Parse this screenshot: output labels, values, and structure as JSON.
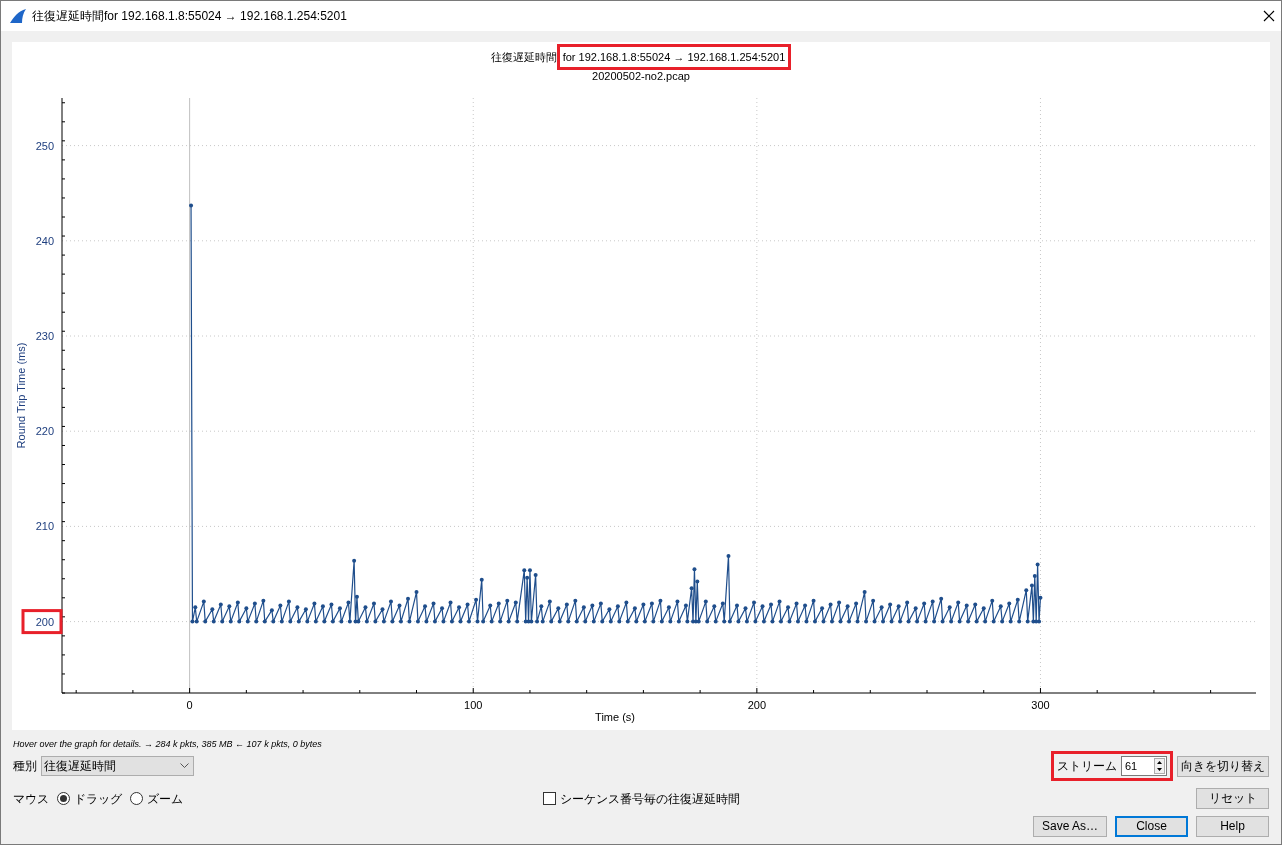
{
  "window": {
    "title": "往復遅延時間for 192.168.1.8:55024 → 192.168.1.254:5201"
  },
  "graph": {
    "title_parts": [
      {
        "text": "往復遅延時間",
        "highlighted": false
      },
      {
        "text": "for 192.168.1.8:55024 → 192.168.1.254:5201",
        "highlighted": true
      }
    ],
    "subtitle": "20200502-no2.pcap",
    "frames": [
      {
        "kind": "y_tick",
        "tick": "200"
      }
    ],
    "chart_data": {
      "type": "line",
      "grid": true,
      "xlabel": "Time (s)",
      "ylabel": "Round Trip Time (ms)",
      "xlim": [
        -45,
        376
      ],
      "ylim": [
        192.5,
        255
      ],
      "xticks": [
        0,
        100,
        200,
        300
      ],
      "yticks": [
        200,
        210,
        220,
        230,
        240,
        250
      ],
      "x": [
        0.5,
        1,
        2,
        2.5,
        5,
        5.5,
        8,
        8.5,
        11,
        11.5,
        14,
        14.5,
        17,
        17.5,
        20,
        20.5,
        23,
        23.5,
        26,
        26.5,
        29,
        29.5,
        32,
        32.5,
        35,
        35.5,
        38,
        38.5,
        41,
        41.5,
        44,
        44.5,
        47,
        47.5,
        50,
        50.5,
        53,
        53.5,
        56,
        56.5,
        58,
        58.5,
        59,
        59.5,
        62,
        62.5,
        65,
        65.5,
        68,
        68.5,
        71,
        71.5,
        74,
        74.5,
        77,
        77.5,
        80,
        80.5,
        83,
        83.5,
        86,
        86.5,
        89,
        89.5,
        92,
        92.5,
        95,
        95.5,
        98,
        98.5,
        101,
        101.5,
        103,
        103.5,
        106,
        106.5,
        109,
        109.5,
        112,
        112.5,
        115,
        115.5,
        118,
        118.5,
        119,
        119.5,
        120,
        120.5,
        122,
        122.5,
        124,
        124.5,
        127,
        127.5,
        130,
        130.5,
        133,
        133.5,
        136,
        136.5,
        139,
        139.5,
        142,
        142.5,
        145,
        145.5,
        148,
        148.5,
        151,
        151.5,
        154,
        154.5,
        157,
        157.5,
        160,
        160.5,
        163,
        163.5,
        166,
        166.5,
        169,
        169.5,
        172,
        172.5,
        175,
        175.5,
        177,
        177.5,
        178,
        178.5,
        179,
        179.5,
        182,
        182.5,
        185,
        185.5,
        188,
        188.5,
        190,
        190.5,
        193,
        193.5,
        196,
        196.5,
        199,
        199.5,
        202,
        202.5,
        205,
        205.5,
        208,
        208.5,
        211,
        211.5,
        214,
        214.5,
        217,
        217.5,
        220,
        220.5,
        223,
        223.5,
        226,
        226.5,
        229,
        229.5,
        232,
        232.5,
        235,
        235.5,
        238,
        238.5,
        241,
        241.5,
        244,
        244.5,
        247,
        247.5,
        250,
        250.5,
        253,
        253.5,
        256,
        256.5,
        259,
        259.5,
        262,
        262.5,
        265,
        265.5,
        268,
        268.5,
        271,
        271.5,
        274,
        274.5,
        277,
        277.5,
        280,
        280.5,
        283,
        283.5,
        286,
        286.5,
        289,
        289.5,
        292,
        292.5,
        295,
        295.5,
        297,
        297.5,
        298,
        298.5,
        299,
        299.5,
        300
      ],
      "series": [
        {
          "color": "#1f4e8c",
          "values": [
            243.7,
            200,
            201.5,
            200,
            202.1,
            200,
            201.3,
            200,
            201.8,
            200,
            201.6,
            200,
            202.0,
            200,
            201.4,
            200,
            201.9,
            200,
            202.2,
            200,
            201.2,
            200,
            201.7,
            200,
            202.1,
            200,
            201.5,
            200,
            201.3,
            200,
            201.9,
            200,
            201.6,
            200,
            201.8,
            200,
            201.4,
            200,
            202.0,
            200,
            206.4,
            200,
            202.6,
            200,
            201.5,
            200,
            201.9,
            200,
            201.3,
            200,
            202.1,
            200,
            201.7,
            200,
            202.4,
            200,
            203.1,
            200,
            201.6,
            200,
            201.9,
            200,
            201.4,
            200,
            202.0,
            200,
            201.5,
            200,
            201.8,
            200,
            202.3,
            200,
            204.4,
            200,
            201.7,
            200,
            201.9,
            200,
            202.2,
            200,
            202.0,
            200,
            205.4,
            200,
            204.6,
            200,
            205.4,
            200,
            204.9,
            200,
            201.6,
            200,
            202.1,
            200,
            201.4,
            200,
            201.8,
            200,
            202.2,
            200,
            201.5,
            200,
            201.7,
            200,
            201.9,
            200,
            201.3,
            200,
            201.6,
            200,
            202.0,
            200,
            201.4,
            200,
            201.8,
            200,
            201.9,
            200,
            202.2,
            200,
            201.5,
            200,
            202.1,
            200,
            201.7,
            200,
            203.5,
            200,
            205.5,
            200,
            204.2,
            200,
            202.1,
            200,
            201.6,
            200,
            201.9,
            200,
            206.9,
            200,
            201.7,
            200,
            201.4,
            200,
            202.0,
            200,
            201.6,
            200,
            201.8,
            200,
            202.1,
            200,
            201.5,
            200,
            201.9,
            200,
            201.7,
            200,
            202.2,
            200,
            201.4,
            200,
            201.8,
            200,
            202.0,
            200,
            201.6,
            200,
            201.9,
            200,
            203.1,
            200,
            202.2,
            200,
            201.5,
            200,
            201.8,
            200,
            201.6,
            200,
            202.0,
            200,
            201.4,
            200,
            201.9,
            200,
            202.1,
            200,
            202.4,
            200,
            201.5,
            200,
            202.0,
            200,
            201.7,
            200,
            201.8,
            200,
            201.4,
            200,
            202.2,
            200,
            201.6,
            200,
            201.9,
            200,
            202.3,
            200,
            203.3,
            200,
            203.8,
            200,
            204.8,
            200,
            206.0,
            200,
            202.5
          ]
        }
      ]
    }
  },
  "hint": "Hover over the graph for details. → 284 k pkts, 385 MB ← 107 k pkts, 0 bytes",
  "type_field": {
    "label": "種別",
    "value": "往復遅延時間"
  },
  "mouse": {
    "label": "マウス",
    "options": [
      {
        "label": "ドラッグ",
        "selected": true
      },
      {
        "label": "ズーム",
        "selected": false
      }
    ]
  },
  "per_segment": {
    "label": "シーケンス番号毎の往復遅延時間",
    "checked": false
  },
  "stream": {
    "label": "ストリーム",
    "value": "61",
    "highlighted": true
  },
  "buttons": [
    {
      "label": "向きを切り替え",
      "kind": "swap"
    },
    {
      "label": "リセット",
      "kind": "reset"
    },
    {
      "label": "Save As…",
      "kind": "save"
    },
    {
      "label": "Close",
      "kind": "default"
    },
    {
      "label": "Help",
      "kind": "help"
    }
  ]
}
